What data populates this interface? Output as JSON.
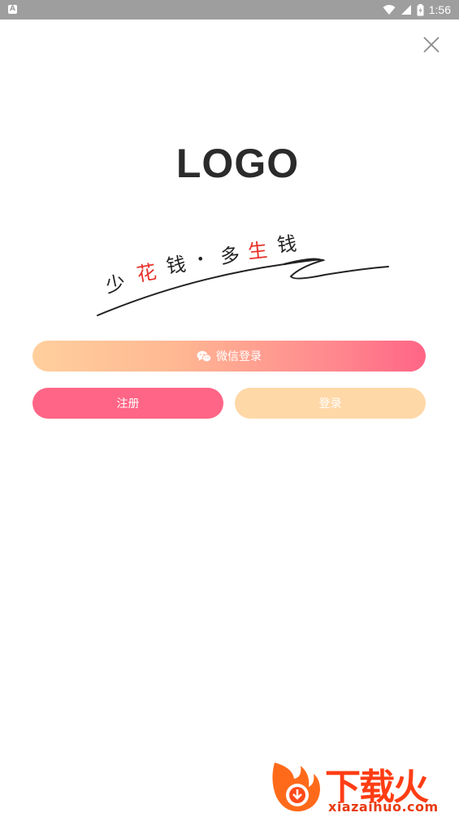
{
  "status_bar": {
    "notification_icon": "A",
    "time": "1:56",
    "icons": [
      "wifi-icon",
      "signal-icon",
      "battery-charging-icon"
    ]
  },
  "header": {
    "close_icon": "close-icon"
  },
  "logo": {
    "text": "LOGO"
  },
  "slogan": {
    "chars": [
      "少",
      "花",
      "钱",
      "•",
      "多",
      "生",
      "钱"
    ],
    "highlight_color": "#e8312b"
  },
  "buttons": {
    "wechat_label": "微信登录",
    "wechat_icon": "wechat-icon",
    "register_label": "注册",
    "login_label": "登录"
  },
  "colors": {
    "register": "#ff6586",
    "login": "#ffd8a8",
    "gradient_start": "#ffcf9d",
    "gradient_end": "#ff6586"
  },
  "watermark": {
    "title": "下载火",
    "url": "xiazaihuo.com"
  }
}
